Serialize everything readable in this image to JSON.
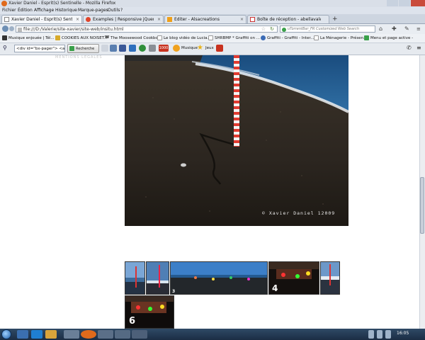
{
  "window": {
    "title": "Xavier Daniel - Esprit(s) Sentinelle - Mozilla Firefox"
  },
  "menu": [
    "Fichier",
    "Édition",
    "Affichage",
    "Historique",
    "Marque-pages",
    "Outils",
    "?"
  ],
  "tabs": [
    {
      "label": "Xavier Daniel - Esprit(s) Sentinelle",
      "active": true
    },
    {
      "label": "Examples | Responsive jQuery Slider | ...",
      "active": false
    },
    {
      "label": "Editer - Alsacreations",
      "active": false
    },
    {
      "label": "Boîte de réception - abellavalerie@g...",
      "active": false
    }
  ],
  "address": {
    "url": "file:///D:/Valerie/site-xavier/site-web/insitu.html"
  },
  "search": {
    "placeholder": "uTorrentBar_FR Customized Web Search"
  },
  "bookmarks": [
    "Musique enjouée | Tél...",
    "COOKIES AUX NOISET...",
    "The Moosewood Cookbook ...",
    "Le blog vidéo de Lucia...",
    "SHRBMP * Graffiti on ...",
    "Graffiti - Graffiti - Inter...",
    "La Ménagerie - Présen...",
    "Menu et page active -"
  ],
  "toolbar": {
    "inspector_value": "<div id=\"bx-pager\"> <a",
    "search_button": "Recherche",
    "badge": "1000",
    "music": "Musique",
    "games": "Jeux"
  },
  "page": {
    "mentions": "MENTIONS LÉGALES",
    "watermark": "© Xavier Daniel 12009",
    "thumb_numbers": [
      "3",
      "4",
      "6"
    ]
  },
  "taskbar": {
    "clock": "16:05"
  }
}
